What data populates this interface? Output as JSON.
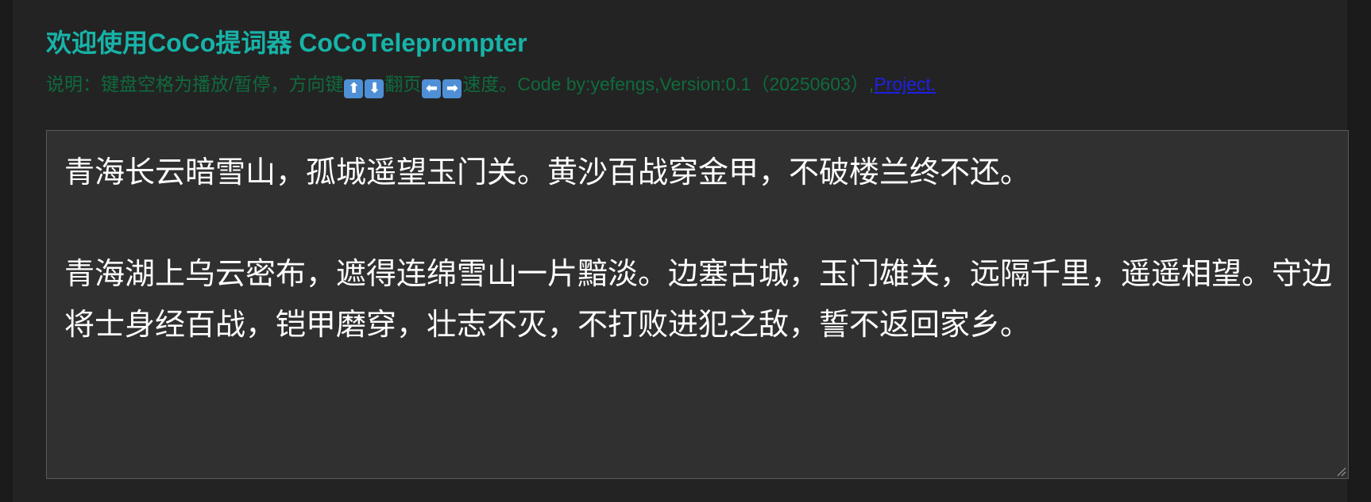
{
  "header": {
    "title": "欢迎使用CoCo提词器 CoCoTeleprompter",
    "desc_part1": "说明：键盘空格为播放/暂停，方向键",
    "key_up": "⬆",
    "key_down": "⬇",
    "desc_part2": "翻页",
    "key_left": "⬅",
    "key_right": "➡",
    "desc_part3": "速度。Code by:yefengs,Version:0.1（20250603）,",
    "project_link": "Project."
  },
  "editor": {
    "text": "青海长云暗雪山，孤城遥望玉门关。黄沙百战穿金甲，不破楼兰终不还。\n\n青海湖上乌云密布，遮得连绵雪山一片黯淡。边塞古城，玉门雄关，远隔千里，遥遥相望。守边将士身经百战，铠甲磨穿，壮志不灭，不打败进犯之敌，誓不返回家乡。"
  },
  "colors": {
    "title": "#17b3a8",
    "description": "#0f6b3c",
    "link": "#1e20e6",
    "editor_bg": "#303030",
    "page_bg": "#232323"
  },
  "icons": {
    "up": "arrow-up-key-icon",
    "down": "arrow-down-key-icon",
    "left": "arrow-left-key-icon",
    "right": "arrow-right-key-icon"
  }
}
